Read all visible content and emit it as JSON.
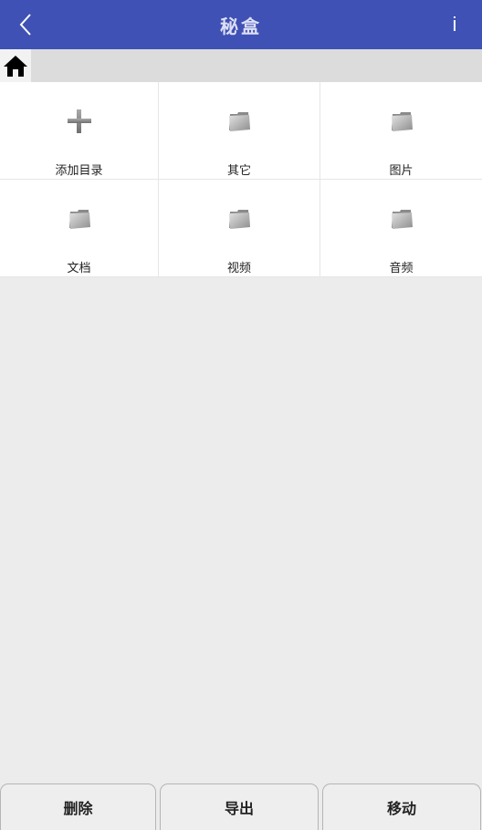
{
  "header": {
    "title": "秘盒",
    "info_label": "i",
    "back_icon": "chevron-left-icon",
    "color": "#3f51b5"
  },
  "breadcrumb": {
    "home_icon": "home-icon"
  },
  "grid": {
    "items": [
      {
        "label": "添加目录",
        "icon": "plus-icon"
      },
      {
        "label": "其它",
        "icon": "folder-icon"
      },
      {
        "label": "图片",
        "icon": "folder-icon"
      },
      {
        "label": "文档",
        "icon": "folder-icon"
      },
      {
        "label": "视频",
        "icon": "folder-icon"
      },
      {
        "label": "音频",
        "icon": "folder-icon"
      }
    ]
  },
  "actions": {
    "delete_label": "删除",
    "export_label": "导出",
    "move_label": "移动"
  }
}
